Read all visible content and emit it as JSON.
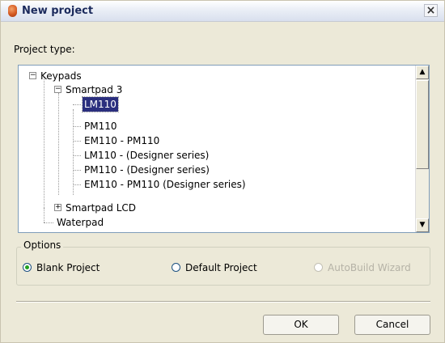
{
  "window": {
    "title": "New project",
    "close_glyph": "×"
  },
  "project_type_label": "Project type:",
  "tree": {
    "expand_glyph": "+",
    "collapse_glyph": "−",
    "nodes": [
      {
        "label": "Keypads",
        "expanded": true,
        "level": 0
      },
      {
        "label": "Smartpad 3",
        "expanded": true,
        "level": 1
      },
      {
        "label": "LM110",
        "level": 2,
        "selected": true
      },
      {
        "label": "PM110",
        "level": 2
      },
      {
        "label": "EM110 - PM110",
        "level": 2
      },
      {
        "label": "LM110 - (Designer series)",
        "level": 2
      },
      {
        "label": "PM110 - (Designer series)",
        "level": 2
      },
      {
        "label": "EM110 - PM110 (Designer series)",
        "level": 2
      },
      {
        "label": "Smartpad LCD",
        "expanded": false,
        "level": 1
      },
      {
        "label": "Waterpad",
        "level": 1
      }
    ],
    "scroll_up_glyph": "▲",
    "scroll_down_glyph": "▼"
  },
  "options": {
    "legend": "Options",
    "radios": [
      {
        "label": "Blank Project",
        "checked": true,
        "disabled": false
      },
      {
        "label": "Default Project",
        "checked": false,
        "disabled": false
      },
      {
        "label": "AutoBuild Wizard",
        "checked": false,
        "disabled": true
      }
    ]
  },
  "buttons": {
    "ok": "OK",
    "cancel": "Cancel"
  },
  "colors": {
    "selection": "#2b2f7e",
    "dialog_bg": "#ece9d8",
    "title_text": "#1b2a5c"
  }
}
